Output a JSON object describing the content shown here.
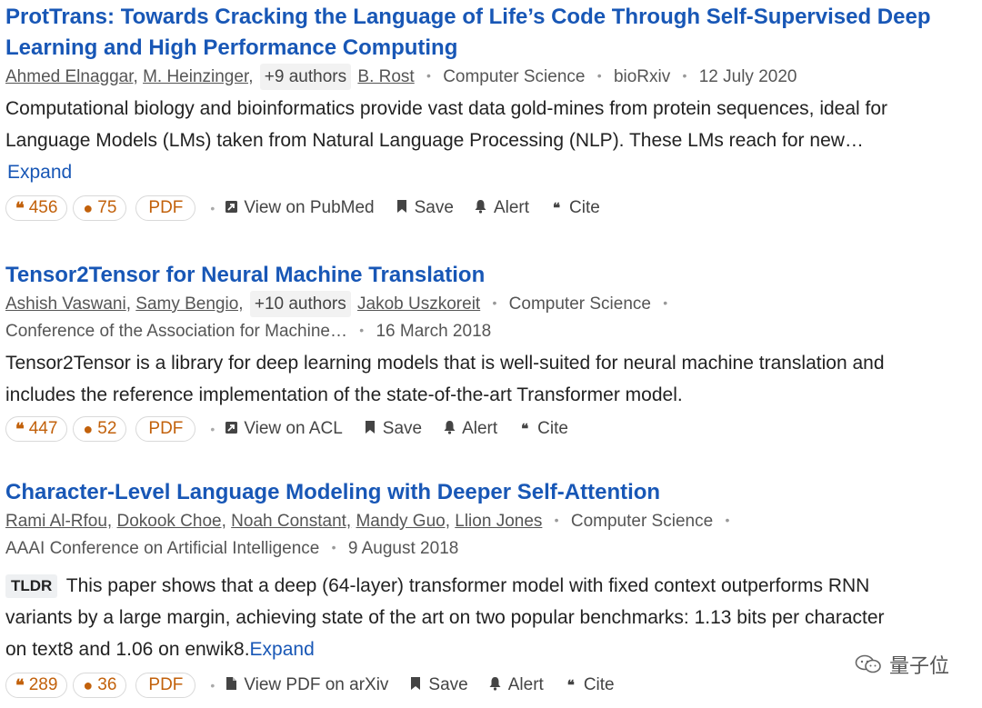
{
  "results": [
    {
      "title_line1": "ProtTrans: Towards Cracking the Language of Life’s Code Through Self-Supervised Deep",
      "title_line2": "Learning and High Performance Computing",
      "authors": [
        "Ahmed Elnaggar",
        "M. Heinzinger,"
      ],
      "more_authors": "+9 authors",
      "last_author": "B. Rost",
      "field": "Computer Science",
      "venue": "bioRxiv",
      "date": "12 July 2020",
      "abstract_line1": "Computational biology and bioinformatics provide vast data gold-mines from protein sequences, ideal for",
      "abstract_line2": "Language Models (LMs) taken from Natural Language Processing (NLP). These LMs reach for new…",
      "expand_label": "Expand",
      "citations": "456",
      "influential": "75",
      "pdf_label": "PDF",
      "view_label": "View on PubMed",
      "save_label": "Save",
      "alert_label": "Alert",
      "cite_label": "Cite"
    },
    {
      "title": "Tensor2Tensor for Neural Machine Translation",
      "authors": [
        "Ashish Vaswani",
        "Samy Bengio,"
      ],
      "more_authors": "+10 authors",
      "last_author": "Jakob Uszkoreit",
      "field": "Computer Science",
      "venue": "Conference of the Association for Machine…",
      "date": "16 March 2018",
      "abstract_line1": "Tensor2Tensor is a library for deep learning models that is well-suited for neural machine translation and",
      "abstract_line2": "includes the reference implementation of the state-of-the-art Transformer model.",
      "citations": "447",
      "influential": "52",
      "pdf_label": "PDF",
      "view_label": "View on ACL",
      "save_label": "Save",
      "alert_label": "Alert",
      "cite_label": "Cite"
    },
    {
      "title": "Character-Level Language Modeling with Deeper Self-Attention",
      "authors": [
        "Rami Al-Rfou,",
        "Dokook Choe,",
        "Noah Constant,",
        "Mandy Guo,",
        "Llion Jones"
      ],
      "field": "Computer Science",
      "venue": "AAAI Conference on Artificial Intelligence",
      "date": "9 August 2018",
      "tldr_label": "TLDR",
      "abstract_line1": "This paper shows that a deep (64-layer) transformer model with fixed context outperforms RNN",
      "abstract_line2": "variants by a large margin, achieving state of the art on two popular benchmarks: 1.13 bits per character",
      "abstract_line3": "on text8 and 1.06 on enwik8.",
      "expand_label": "Expand",
      "citations": "289",
      "influential": "36",
      "pdf_label": "PDF",
      "view_label": "View PDF on arXiv",
      "save_label": "Save",
      "alert_label": "Alert",
      "cite_label": "Cite"
    }
  ],
  "watermark": "量子位",
  "icons": {
    "citation": "quote-icon",
    "influential": "lightbulb-icon",
    "view": "external-link-icon",
    "pdf_file": "file-icon",
    "save": "bookmark-icon",
    "alert": "bell-icon",
    "cite": "quote-icon"
  },
  "colors": {
    "title": "#1857b6",
    "citation_accent": "#c2610b",
    "meta": "#555555"
  }
}
